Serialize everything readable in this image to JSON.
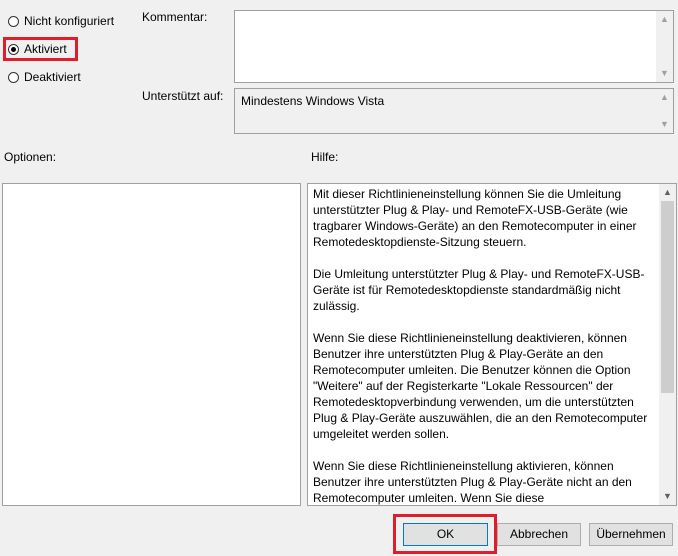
{
  "state": {
    "options": [
      {
        "label": "Nicht konfiguriert",
        "selected": false
      },
      {
        "label": "Aktiviert",
        "selected": true
      },
      {
        "label": "Deaktiviert",
        "selected": false
      }
    ]
  },
  "comment": {
    "label": "Kommentar:",
    "value": ""
  },
  "supported": {
    "label": "Unterstützt auf:",
    "value": "Mindestens Windows Vista"
  },
  "options_panel": {
    "label": "Optionen:"
  },
  "help": {
    "label": "Hilfe:",
    "paragraphs": [
      "Mit dieser Richtlinieneinstellung können Sie die Umleitung unterstützter Plug & Play- und RemoteFX-USB-Geräte (wie tragbarer Windows-Geräte) an den Remotecomputer in einer Remotedesktopdienste-Sitzung steuern.",
      "Die Umleitung unterstützter Plug & Play- und RemoteFX-USB-Geräte ist für Remotedesktopdienste standardmäßig nicht zulässig.",
      "Wenn Sie diese Richtlinieneinstellung deaktivieren, können Benutzer ihre unterstützten Plug & Play-Geräte an den Remotecomputer umleiten. Die Benutzer können die Option \"Weitere\" auf der Registerkarte \"Lokale Ressourcen\" der Remotedesktopverbindung verwenden, um die unterstützten Plug & Play-Geräte auszuwählen, die an den Remotecomputer umgeleitet werden sollen.",
      "Wenn Sie diese Richtlinieneinstellung aktivieren, können Benutzer ihre unterstützten Plug & Play-Geräte nicht an den Remotecomputer umleiten. Wenn Sie diese Richtlinieneinstellung nicht konfigurieren, können Benutzer ihre"
    ]
  },
  "buttons": {
    "ok": "OK",
    "cancel": "Abbrechen",
    "apply": "Übernehmen"
  }
}
